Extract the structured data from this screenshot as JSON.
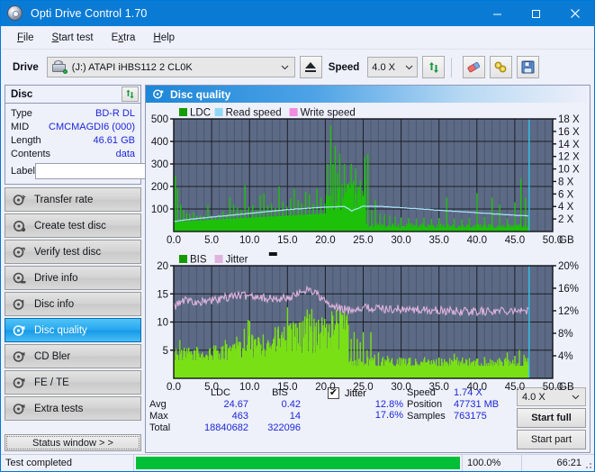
{
  "window": {
    "title": "Opti Drive Control 1.70",
    "icon": "disc-icon",
    "minimize": "─",
    "maximize": "☐",
    "close": "✕"
  },
  "menu": {
    "items": [
      {
        "label": "File",
        "accel": "F"
      },
      {
        "label": "Start test",
        "accel": "S"
      },
      {
        "label": "Extra",
        "accel": "x"
      },
      {
        "label": "Help",
        "accel": "H"
      }
    ]
  },
  "toolbar": {
    "drive_label": "Drive",
    "drive_value": "(J:)  ATAPI iHBS112  2 CL0K",
    "eject_label": "eject-button",
    "speed_label": "Speed",
    "speed_value": "4.0 X",
    "refresh_label": "refresh-button",
    "eraser_label": "eraser-button",
    "tools_label": "tools-button",
    "save_label": "save-button"
  },
  "sidebar": {
    "disc_panel": {
      "title": "Disc",
      "refresh_label": "refresh-disc-button",
      "rows": [
        {
          "key": "Type",
          "value": "BD-R DL"
        },
        {
          "key": "MID",
          "value": "CMCMAGDI6 (000)"
        },
        {
          "key": "Length",
          "value": "46.61 GB"
        },
        {
          "key": "Contents",
          "value": "data"
        }
      ],
      "label_key": "Label",
      "label_value": "",
      "label_placeholder": ""
    },
    "nav": [
      {
        "label": "Transfer rate",
        "icon": "disc-speed-icon",
        "active": false
      },
      {
        "label": "Create test disc",
        "icon": "disc-create-icon",
        "active": false
      },
      {
        "label": "Verify test disc",
        "icon": "disc-verify-icon",
        "active": false
      },
      {
        "label": "Drive info",
        "icon": "drive-info-icon",
        "active": false
      },
      {
        "label": "Disc info",
        "icon": "disc-info-icon",
        "active": false
      },
      {
        "label": "Disc quality",
        "icon": "disc-quality-icon",
        "active": true
      },
      {
        "label": "CD Bler",
        "icon": "cd-bler-icon",
        "active": false
      },
      {
        "label": "FE / TE",
        "icon": "fe-te-icon",
        "active": false
      },
      {
        "label": "Extra tests",
        "icon": "extra-tests-icon",
        "active": false
      }
    ],
    "status_window_button": "Status window > >"
  },
  "content": {
    "header_title": "Disc quality",
    "header_icon": "disc-quality-icon"
  },
  "stats": {
    "columns": [
      "LDC",
      "BIS"
    ],
    "rows": [
      {
        "label": "Avg",
        "ldc": "24.67",
        "bis": "0.42",
        "jitter": "12.8%"
      },
      {
        "label": "Max",
        "ldc": "463",
        "bis": "14",
        "jitter": "17.6%"
      },
      {
        "label": "Total",
        "ldc": "18840682",
        "bis": "322096",
        "jitter": ""
      }
    ],
    "jitter_label": "Jitter",
    "jitter_checked": true,
    "jitter_check_glyph": "✔",
    "speed_key": "Speed",
    "speed_value": "1.74 X",
    "position_key": "Position",
    "position_value": "47731 MB",
    "samples_key": "Samples",
    "samples_value": "763175",
    "speed_select": "4.0 X",
    "start_full": "Start full",
    "start_part": "Start part"
  },
  "statusbar": {
    "message": "Test completed",
    "percent_text": "100.0%",
    "percent_value": 100,
    "elapsed": "66:21"
  },
  "colors": {
    "accent": "#0a7bd4",
    "plot_bg": "#5c6a85",
    "ldc_green": "#1ec10a",
    "bis_green": "#7ae016",
    "read_speed": "#8fd8f5",
    "write_speed": "#f08ce0",
    "jitter_pink": "#e0aedd",
    "value_blue": "#1c28d8",
    "progress_green": "#00bf36"
  },
  "chart_data": [
    {
      "type": "line",
      "name": "ldc-chart",
      "title": "",
      "xlabel": "GB",
      "ylabel": "",
      "xlim": [
        0.0,
        50.0
      ],
      "xticks": [
        "0.0",
        "5.0",
        "10.0",
        "15.0",
        "20.0",
        "25.0",
        "30.0",
        "35.0",
        "40.0",
        "45.0",
        "50.0"
      ],
      "x_unit": "GB",
      "ylim": [
        0,
        500
      ],
      "yticks": [
        "100",
        "200",
        "300",
        "400",
        "500"
      ],
      "y2lim": [
        0,
        18
      ],
      "y2ticks": [
        "2 X",
        "4 X",
        "6 X",
        "8 X",
        "10 X",
        "12 X",
        "14 X",
        "16 X",
        "18 X"
      ],
      "grid": true,
      "legend_position": "top-left",
      "legend": [
        {
          "label": "LDC",
          "color": "#149b00"
        },
        {
          "label": "Read speed",
          "color": "#8fd8f5"
        },
        {
          "label": "Write speed",
          "color": "#f08ce0"
        }
      ],
      "series": [
        {
          "name": "LDC",
          "kind": "bars",
          "color": "#1ec10a",
          "x": [
            0.2,
            0.5,
            0.9,
            1.3,
            1.7,
            2.1,
            2.6,
            3.0,
            3.5,
            4.0,
            4.5,
            5.0,
            5.5,
            6.0,
            6.5,
            7.0,
            7.4,
            7.9,
            8.4,
            8.9,
            9.4,
            9.9,
            10.4,
            10.9,
            11.4,
            11.9,
            12.4,
            12.9,
            13.4,
            13.9,
            14.4,
            14.9,
            15.4,
            15.9,
            16.4,
            16.9,
            17.4,
            17.9,
            18.4,
            18.9,
            19.4,
            19.9,
            20.3,
            20.7,
            21.0,
            21.3,
            21.6,
            21.9,
            22.2,
            22.5,
            22.8,
            23.1,
            23.4,
            23.7,
            24.0,
            24.3,
            24.6,
            24.9,
            25.2,
            25.6,
            26.1,
            26.6,
            27.2,
            27.8,
            28.5,
            29.2,
            30.0,
            31.0,
            32.0,
            33.0,
            34.0,
            35.0,
            36.0,
            37.0,
            38.0,
            39.0,
            40.0,
            41.0,
            42.0,
            43.0,
            44.0,
            45.0,
            45.8,
            46.4,
            46.8
          ],
          "y": [
            248,
            190,
            120,
            95,
            80,
            78,
            85,
            70,
            72,
            68,
            118,
            70,
            66,
            74,
            90,
            78,
            150,
            120,
            106,
            98,
            205,
            110,
            118,
            96,
            160,
            170,
            115,
            125,
            104,
            200,
            130,
            112,
            148,
            190,
            140,
            125,
            176,
            166,
            122,
            190,
            150,
            126,
            300,
            470,
            300,
            380,
            260,
            345,
            210,
            300,
            210,
            160,
            300,
            220,
            280,
            200,
            230,
            180,
            330,
            345,
            95,
            140,
            80,
            75,
            70,
            65,
            62,
            60,
            58,
            62,
            56,
            60,
            150,
            58,
            54,
            60,
            170,
            65,
            150,
            120,
            58,
            130,
            235,
            150,
            60
          ]
        },
        {
          "name": "Read speed",
          "kind": "line",
          "color": "#a9e4fa",
          "x": [
            0.0,
            2.5,
            5.0,
            7.5,
            10.0,
            12.5,
            15.0,
            17.5,
            20.0,
            22.5,
            23.5,
            25.0,
            27.5,
            30.0,
            32.5,
            35.0,
            37.5,
            40.0,
            42.5,
            45.0,
            46.8
          ],
          "y": [
            1.6,
            2.0,
            2.3,
            2.6,
            2.9,
            3.2,
            3.5,
            3.7,
            3.9,
            4.0,
            3.3,
            4.05,
            4.0,
            3.8,
            3.6,
            3.4,
            3.2,
            3.0,
            2.8,
            2.6,
            2.5
          ]
        },
        {
          "name": "Write speed",
          "kind": "marker",
          "color": "#f08ce0",
          "x": [],
          "y": []
        },
        {
          "name": "Cursor",
          "kind": "vline",
          "color": "#38c6f4",
          "x": [
            46.9
          ]
        }
      ]
    },
    {
      "type": "line",
      "name": "bis-jitter-chart",
      "title": "",
      "xlabel": "GB",
      "ylabel": "",
      "xlim": [
        0.0,
        50.0
      ],
      "xticks": [
        "0.0",
        "5.0",
        "10.0",
        "15.0",
        "20.0",
        "25.0",
        "30.0",
        "35.0",
        "40.0",
        "45.0",
        "50.0"
      ],
      "x_unit": "GB",
      "ylim": [
        0,
        20
      ],
      "yticks": [
        "5",
        "10",
        "15",
        "20"
      ],
      "y2lim": [
        0,
        20
      ],
      "y2ticks": [
        "4%",
        "8%",
        "12%",
        "16%",
        "20%"
      ],
      "grid": true,
      "legend_position": "top-left",
      "legend": [
        {
          "label": "BIS",
          "color": "#149b00"
        },
        {
          "label": "Jitter",
          "color": "#dfb3dd"
        }
      ],
      "series": [
        {
          "name": "BIS",
          "kind": "bars",
          "color": "#7ae016",
          "x": [
            0.3,
            0.8,
            1.3,
            1.8,
            2.3,
            2.8,
            3.3,
            3.8,
            4.3,
            4.8,
            5.3,
            5.8,
            6.3,
            6.8,
            7.3,
            7.8,
            8.3,
            8.8,
            9.3,
            9.8,
            10.0,
            10.3,
            10.8,
            11.3,
            11.8,
            12.3,
            12.8,
            13.3,
            13.8,
            14.3,
            14.8,
            15.0,
            15.3,
            15.8,
            16.3,
            16.8,
            17.3,
            17.6,
            17.9,
            18.2,
            18.5,
            18.8,
            19.1,
            19.4,
            19.7,
            20.0,
            20.4,
            20.8,
            21.2,
            21.6,
            22.0,
            22.4,
            22.8,
            23.0,
            23.4,
            23.8,
            24.2,
            24.6,
            25.0,
            25.5,
            26.0,
            26.5,
            27.0,
            27.6,
            28.2,
            28.8,
            29.5,
            30.2,
            31.0,
            32.0,
            33.0,
            34.0,
            35.0,
            36.0,
            37.0,
            38.0,
            39.0,
            40.0,
            41.0,
            42.0,
            43.0,
            44.0,
            45.0,
            45.6,
            46.2,
            46.7
          ],
          "y": [
            5.2,
            6.8,
            5.0,
            4.5,
            4.8,
            5.0,
            4.4,
            4.6,
            4.2,
            5.4,
            4.8,
            5.0,
            5.6,
            6.8,
            5.4,
            6.0,
            7.4,
            6.4,
            8.8,
            10.4,
            10.2,
            7.8,
            7.0,
            6.4,
            7.8,
            6.2,
            5.8,
            7.4,
            9.2,
            8.2,
            6.8,
            12.6,
            7.2,
            8.2,
            9.0,
            10.0,
            11.0,
            12.2,
            11.4,
            12.3,
            10.6,
            10.0,
            9.2,
            8.0,
            9.4,
            9.0,
            8.2,
            7.4,
            8.6,
            7.8,
            6.2,
            8.8,
            11.0,
            9.5,
            7.0,
            8.2,
            7.0,
            6.4,
            8.2,
            5.0,
            8.2,
            4.2,
            4.6,
            3.8,
            4.0,
            3.6,
            3.4,
            3.2,
            3.6,
            3.0,
            3.4,
            3.2,
            3.6,
            3.0,
            4.4,
            3.2,
            3.6,
            3.0,
            3.8,
            3.2,
            3.4,
            4.6,
            4.0,
            5.0,
            4.2,
            3.6
          ]
        },
        {
          "name": "Jitter",
          "kind": "line",
          "color": "#dfb3dd",
          "x": [
            0.0,
            1.0,
            2.0,
            3.0,
            4.0,
            5.0,
            6.0,
            7.0,
            8.0,
            9.0,
            10.0,
            11.0,
            12.0,
            13.0,
            14.0,
            15.0,
            16.0,
            17.0,
            17.8,
            18.5,
            19.5,
            20.3,
            21.0,
            22.0,
            23.0,
            24.0,
            25.0,
            27.0,
            29.0,
            31.0,
            33.0,
            35.0,
            37.0,
            39.0,
            41.0,
            43.0,
            45.0,
            46.0,
            46.8
          ],
          "y": [
            12.6,
            13.6,
            14.0,
            13.5,
            13.6,
            13.8,
            14.0,
            14.4,
            14.8,
            14.6,
            14.8,
            14.6,
            14.3,
            14.0,
            14.2,
            14.3,
            14.6,
            15.6,
            15.8,
            15.4,
            14.2,
            13.2,
            12.6,
            12.4,
            12.1,
            12.4,
            12.6,
            12.4,
            12.3,
            12.2,
            12.1,
            12.0,
            11.9,
            11.9,
            11.9,
            12.0,
            12.2,
            12.0,
            11.8
          ]
        },
        {
          "name": "Cursor",
          "kind": "vline",
          "color": "#38c6f4",
          "x": [
            46.9
          ]
        }
      ]
    }
  ]
}
